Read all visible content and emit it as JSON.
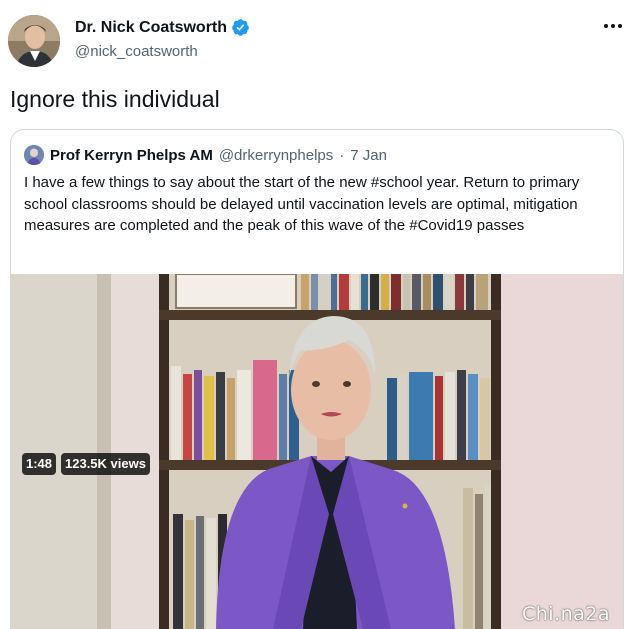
{
  "tweet": {
    "author_name": "Dr. Nick Coatsworth",
    "author_handle": "@nick_coatsworth",
    "text": "Ignore this individual"
  },
  "quote": {
    "author_name": "Prof Kerryn Phelps AM",
    "author_handle": "@drkerrynphelps",
    "separator": "·",
    "date": "7 Jan",
    "text": "I have a few things to say about the start of the new #school year. Return to primary school classrooms should be delayed until vaccination levels are optimal, mitigation measures are completed and the peak of this wave of the #Covid19 passes",
    "video": {
      "duration": "1:48",
      "views": "123.5K views"
    }
  },
  "watermark": "Chi.na2a",
  "colors": {
    "verified": "#1d9bf0",
    "text": "#0f1419",
    "muted": "#536471",
    "border": "#cfd9de"
  }
}
